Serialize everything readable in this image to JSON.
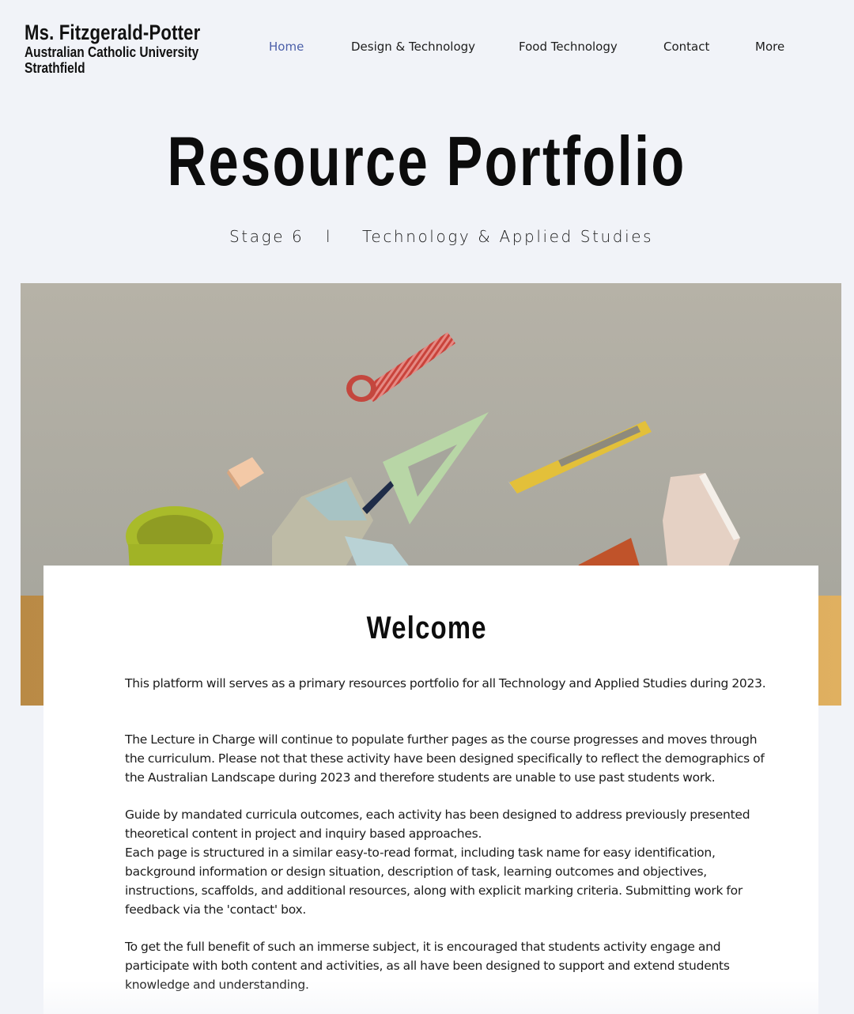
{
  "brand": {
    "name": "Ms. Fitzgerald-Potter",
    "line1": "Australian Catholic University",
    "line2": "Strathfield"
  },
  "nav": {
    "items": [
      {
        "label": "Home",
        "active": true
      },
      {
        "label": "Design & Technology",
        "active": false
      },
      {
        "label": "Food Technology",
        "active": false
      },
      {
        "label": "Contact",
        "active": false
      },
      {
        "label": "More",
        "active": false
      }
    ]
  },
  "hero": {
    "title": "Resource Portfolio",
    "subtitle_left": "Stage 6",
    "subtitle_separator": "l",
    "subtitle_right": "Technology & Applied Studies"
  },
  "welcome": {
    "heading": "Welcome",
    "paragraphs": [
      "This platform will serves as a primary resources portfolio for all Technology and Applied Studies during 2023.",
      "The Lecture in Charge will continue to populate further pages as the course progresses and moves through the curriculum. Please not that these activity have been designed specifically to reflect the demographics of the Australian Landscape during 2023 and therefore students are unable to use past students work.",
      "Guide by mandated curricula outcomes, each activity has been designed to address previously presented theoretical content in project and inquiry based approaches.",
      "Each page is structured in a similar easy-to-read format, including task name for easy identification, background information or design situation, description of task, learning outcomes and objectives, instructions, scaffolds, and additional resources, along with explicit marking criteria. Submitting work for feedback via the 'contact' box.",
      "To get the full benefit of such an immerse subject, it is encouraged that students activity engage and participate with both content and activities, as all have been designed to support and extend students knowledge and understanding."
    ]
  },
  "colors": {
    "background": "#f1f3f8",
    "accent": "#4a5ea8",
    "card": "#ffffff"
  }
}
